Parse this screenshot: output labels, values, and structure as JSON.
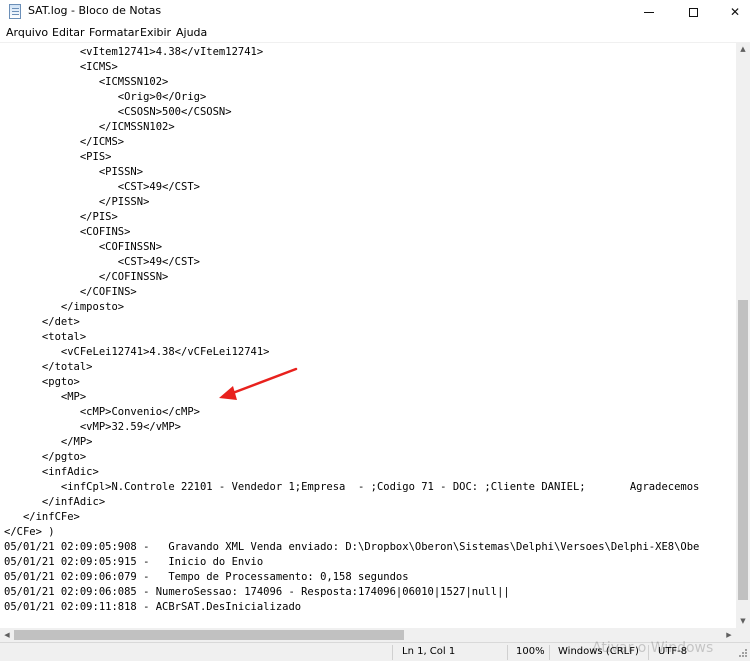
{
  "window": {
    "title": "SAT.log - Bloco de Notas",
    "controls": {
      "minimize": "minimize-icon",
      "maximize": "maximize-icon",
      "close": "✕"
    }
  },
  "menu": {
    "items": [
      {
        "label": "Arquivo"
      },
      {
        "label": "Editar"
      },
      {
        "label": "Formatar"
      },
      {
        "label": "Exibir"
      },
      {
        "label": "Ajuda"
      }
    ]
  },
  "editor": {
    "lines": [
      "            <vItem12741>4.38</vItem12741>",
      "            <ICMS>",
      "               <ICMSSN102>",
      "                  <Orig>0</Orig>",
      "                  <CSOSN>500</CSOSN>",
      "               </ICMSSN102>",
      "            </ICMS>",
      "            <PIS>",
      "               <PISSN>",
      "                  <CST>49</CST>",
      "               </PISSN>",
      "            </PIS>",
      "            <COFINS>",
      "               <COFINSSN>",
      "                  <CST>49</CST>",
      "               </COFINSSN>",
      "            </COFINS>",
      "         </imposto>",
      "      </det>",
      "      <total>",
      "         <vCFeLei12741>4.38</vCFeLei12741>",
      "      </total>",
      "      <pgto>",
      "         <MP>",
      "            <cMP>Convenio</cMP>",
      "            <vMP>32.59</vMP>",
      "         </MP>",
      "      </pgto>",
      "      <infAdic>",
      "         <infCpl>N.Controle 22101 - Vendedor 1;Empresa  - ;Codigo 71 - DOC: ;Cliente DANIEL;       Agradecemos",
      "      </infAdic>",
      "   </infCFe>",
      "</CFe> )",
      "05/01/21 02:09:05:908 -   Gravando XML Venda enviado: D:\\Dropbox\\Oberon\\Sistemas\\Delphi\\Versoes\\Delphi-XE8\\Obe",
      "05/01/21 02:09:05:915 -   Inicio do Envio",
      "05/01/21 02:09:06:079 -   Tempo de Processamento: 0,158 segundos",
      "05/01/21 02:09:06:085 - NumeroSessao: 174096 - Resposta:174096|06010|1527|null||",
      "05/01/21 02:09:11:818 - ACBrSAT.DesInicializado"
    ],
    "annotation_color": "#e8211d"
  },
  "statusbar": {
    "position": "Ln 1, Col 1",
    "zoom": "100%",
    "line_ending": "Windows (CRLF)",
    "encoding": "UTF-8",
    "watermark": "Ativar o Windows"
  }
}
